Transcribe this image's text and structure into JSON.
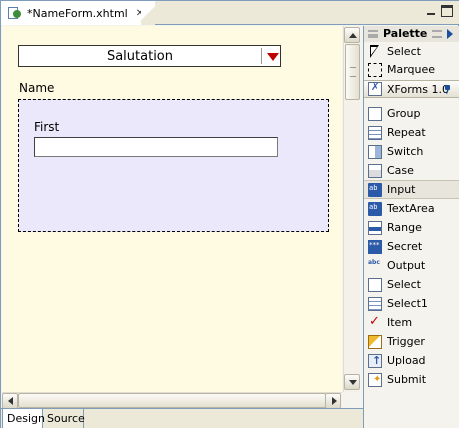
{
  "editor": {
    "tab_title": "*NameForm.xhtml",
    "close_glyph": "✕"
  },
  "form": {
    "select_value": "Salutation",
    "group_label": "Name",
    "input_label": "First",
    "input_value": ""
  },
  "bottom_tabs": [
    {
      "label": "Design",
      "active": true
    },
    {
      "label": "Source",
      "active": false
    }
  ],
  "palette": {
    "title": "Palette",
    "tools": [
      {
        "label": "Select",
        "icon": "arrow-pointer-icon"
      },
      {
        "label": "Marquee",
        "icon": "marquee-icon"
      }
    ],
    "drawer": {
      "label": "XForms 1.0",
      "icon": "xforms-icon",
      "pinned": true
    },
    "items": [
      {
        "label": "Group",
        "icon": "group-icon"
      },
      {
        "label": "Repeat",
        "icon": "repeat-icon"
      },
      {
        "label": "Switch",
        "icon": "switch-icon"
      },
      {
        "label": "Case",
        "icon": "case-icon"
      },
      {
        "label": "Input",
        "icon": "input-icon",
        "selected": true
      },
      {
        "label": "TextArea",
        "icon": "textarea-icon"
      },
      {
        "label": "Range",
        "icon": "range-icon"
      },
      {
        "label": "Secret",
        "icon": "secret-icon"
      },
      {
        "label": "Output",
        "icon": "output-icon"
      },
      {
        "label": "Select",
        "icon": "select-icon"
      },
      {
        "label": "Select1",
        "icon": "select1-icon"
      },
      {
        "label": "Item",
        "icon": "item-check-icon"
      },
      {
        "label": "Trigger",
        "icon": "trigger-icon"
      },
      {
        "label": "Upload",
        "icon": "upload-icon"
      },
      {
        "label": "Submit",
        "icon": "submit-icon"
      }
    ]
  },
  "colors": {
    "canvas_bg": "#fffbe2",
    "group_bg": "#ece8fb",
    "dropdown_arrow": "#c00000",
    "border": "#7f9db9"
  }
}
